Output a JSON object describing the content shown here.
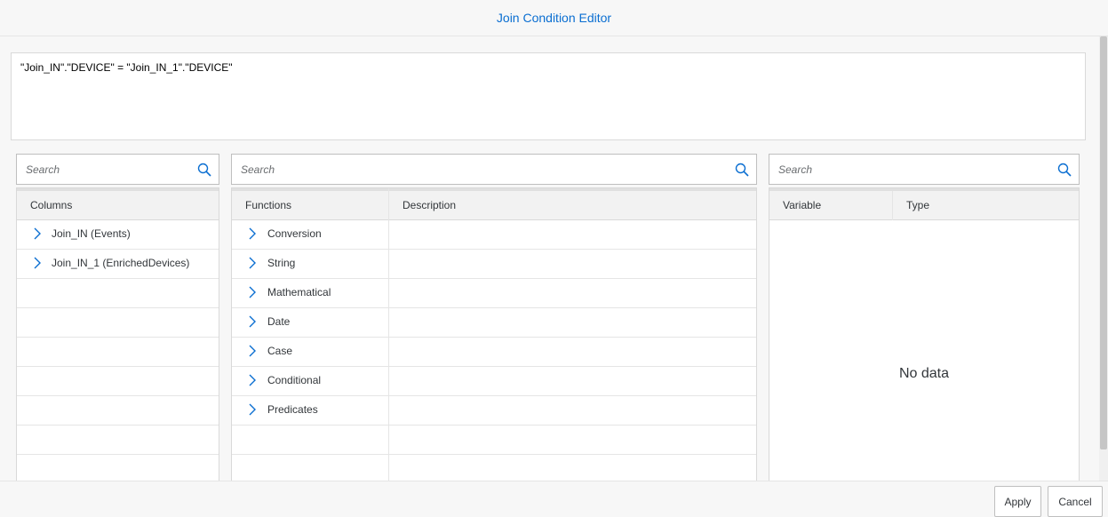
{
  "dialog": {
    "title": "Join Condition Editor"
  },
  "expression": {
    "text": "\"Join_IN\".\"DEVICE\" = \"Join_IN_1\".\"DEVICE\""
  },
  "columns_panel": {
    "search_placeholder": "Search",
    "header": "Columns",
    "items": [
      {
        "label": "Join_IN (Events)"
      },
      {
        "label": "Join_IN_1 (EnrichedDevices)"
      }
    ]
  },
  "functions_panel": {
    "search_placeholder": "Search",
    "headers": {
      "functions": "Functions",
      "description": "Description"
    },
    "items": [
      {
        "label": "Conversion"
      },
      {
        "label": "String"
      },
      {
        "label": "Mathematical"
      },
      {
        "label": "Date"
      },
      {
        "label": "Case"
      },
      {
        "label": "Conditional"
      },
      {
        "label": "Predicates"
      }
    ]
  },
  "variables_panel": {
    "search_placeholder": "Search",
    "headers": {
      "variable": "Variable",
      "type": "Type"
    },
    "empty_text": "No data"
  },
  "footer": {
    "apply_label": "Apply",
    "cancel_label": "Cancel"
  },
  "colors": {
    "accent": "#0a6ed1",
    "chevron": "#0a6ed1"
  },
  "icons": {
    "search": "search-icon",
    "expand": "chevron-right-icon"
  }
}
